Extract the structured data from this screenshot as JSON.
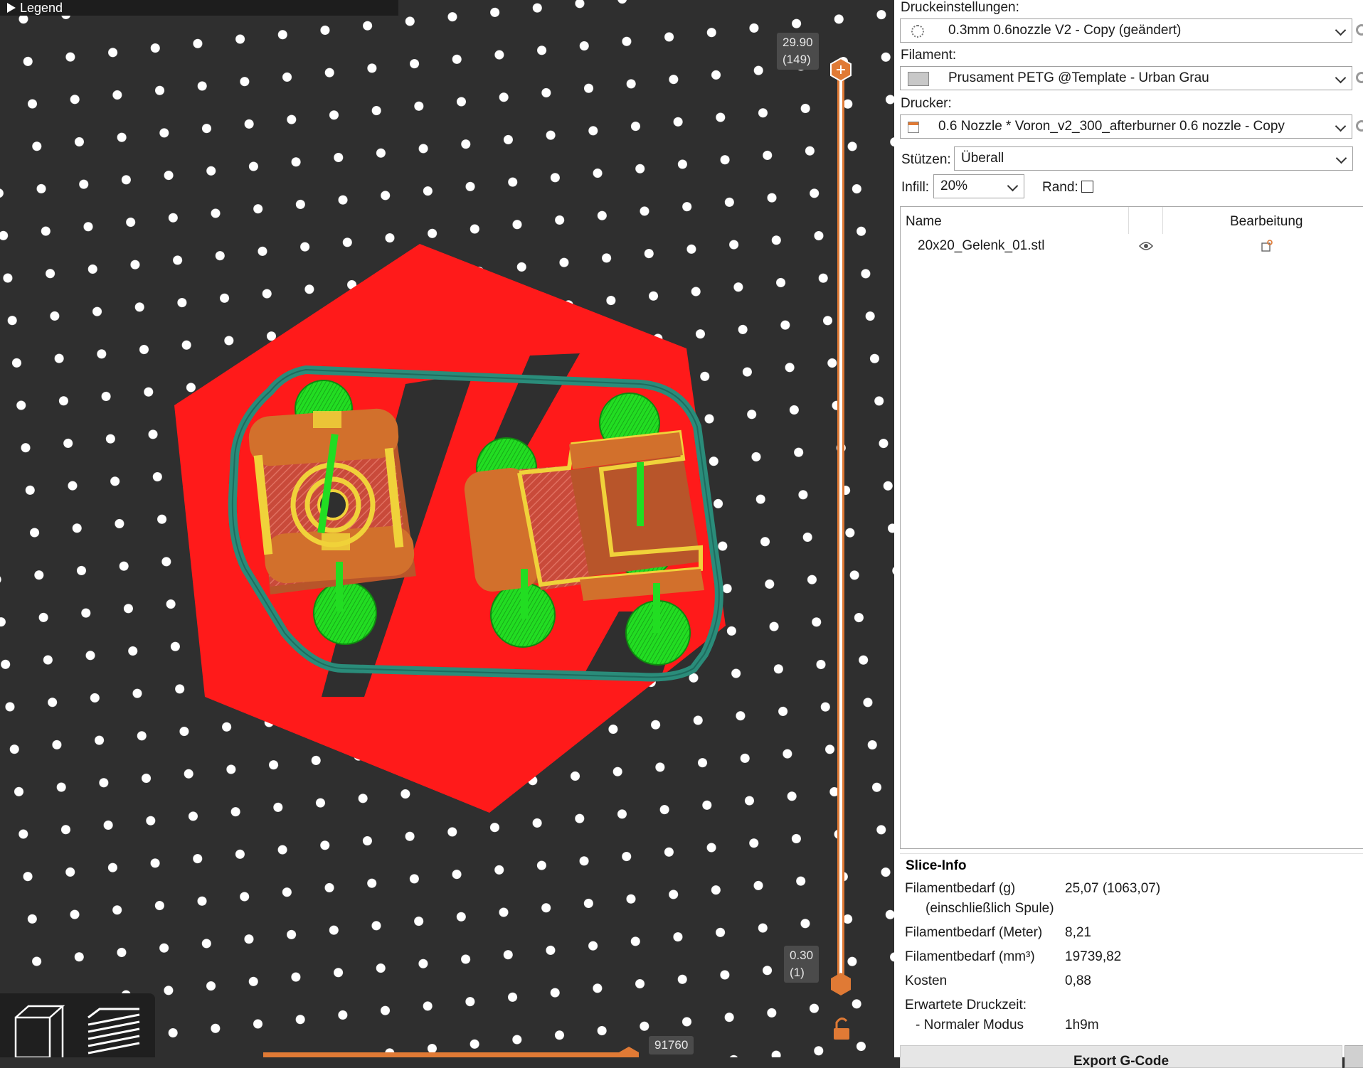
{
  "viewport": {
    "legend_label": "Legend",
    "layer_top": {
      "height": "29.90",
      "layer": "(149)"
    },
    "layer_bottom": {
      "height": "0.30",
      "layer": "(1)"
    },
    "horizontal_value": "91760"
  },
  "sidebar": {
    "print_settings": {
      "label": "Druckeinstellungen:",
      "value": "0.3mm 0.6nozzle V2 - Copy (geändert)",
      "icon": "gear-icon"
    },
    "filament": {
      "label": "Filament:",
      "value": "Prusament PETG @Template - Urban Grau",
      "icon": "filament-color-swatch"
    },
    "printer": {
      "label": "Drucker:",
      "value": "0.6 Nozzle * Voron_v2_300_afterburner 0.6 nozzle - Copy",
      "icon": "printer-icon"
    },
    "supports": {
      "label": "Stützen:",
      "value": "Überall"
    },
    "infill": {
      "label": "Infill:",
      "value": "20%"
    },
    "brim": {
      "label": "Rand:",
      "checked": false
    }
  },
  "object_list": {
    "col_name": "Name",
    "col_edit": "Bearbeitung",
    "rows": [
      {
        "name": "20x20_Gelenk_01.stl"
      }
    ]
  },
  "slice_info": {
    "title": "Slice-Info",
    "rows": [
      {
        "label": "Filamentbedarf (g)",
        "sublabel": "(einschließlich Spule)",
        "value": "25,07 (1063,07)"
      },
      {
        "label": "Filamentbedarf (Meter)",
        "value": "8,21"
      },
      {
        "label": "Filamentbedarf (mm³)",
        "value": "19739,82"
      },
      {
        "label": "Kosten",
        "value": "0,88"
      },
      {
        "label": "Erwartete Druckzeit:",
        "value": ""
      },
      {
        "label": "- Normaler Modus",
        "value": "1h9m"
      }
    ],
    "export_label": "Export G-Code"
  },
  "colors": {
    "bed": "#2f2f2f",
    "bed_dots": "#ffffff",
    "skirt": "#2a8c7a",
    "support": "#ff1a1a",
    "wall": "#d2702c",
    "infill": "#c94a3a",
    "perimeter": "#f0d23a",
    "support_interface": "#22dd22",
    "slider": "#e07a35"
  }
}
